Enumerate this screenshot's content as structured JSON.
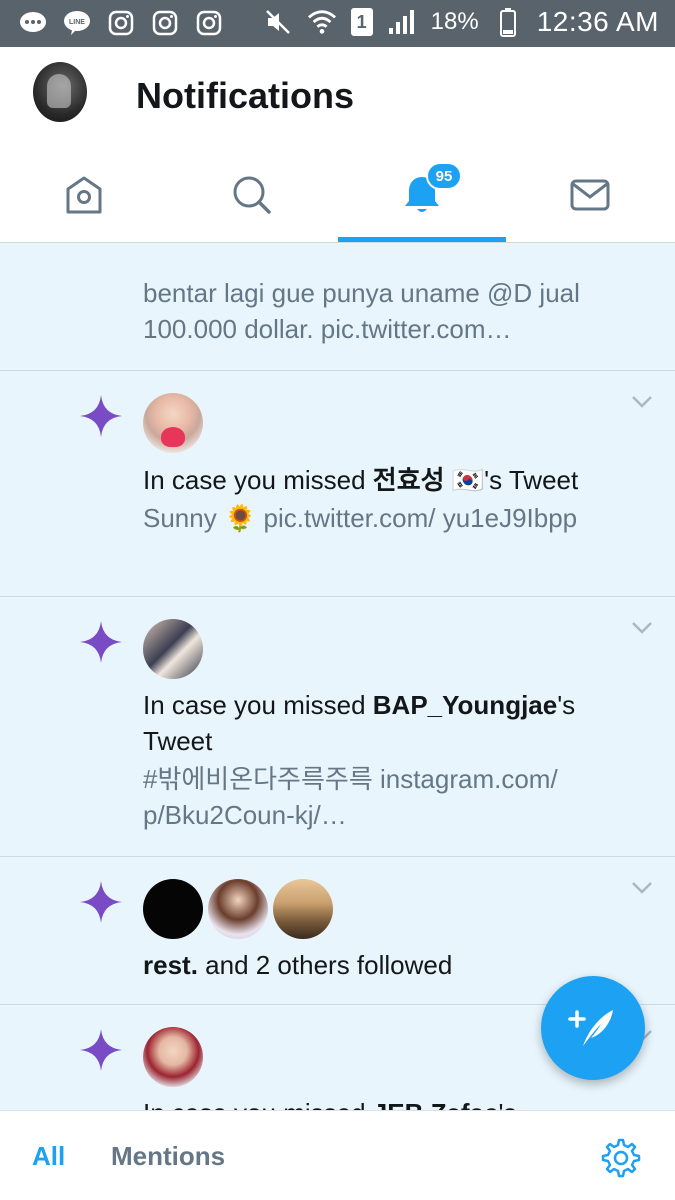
{
  "status_bar": {
    "icons": [
      "chat-icon",
      "line-icon",
      "instagram-icon",
      "instagram-icon",
      "instagram-icon"
    ],
    "sim": "1",
    "battery": "18%",
    "time": "12:36 AM"
  },
  "header": {
    "title": "Notifications"
  },
  "tabs": {
    "items": [
      "home-icon",
      "search-icon",
      "notifications-icon",
      "messages-icon"
    ],
    "badge": "95",
    "active_color": "#1da1f2"
  },
  "feed": {
    "items": [
      {
        "text": "bentar lagi gue punya uname @D jual 100.000 dollar. pic.twitter.com…"
      },
      {
        "prefix": "In case you missed ",
        "user": "전효성 🇰🇷",
        "suffix": "'s Tweet",
        "sub": "Sunny 🌻 pic.twitter.com/ yu1eJ9Ibpp"
      },
      {
        "prefix": "In case you missed ",
        "user": "BAP_Youngjae",
        "suffix": "'s Tweet",
        "sub": "#밖에비온다주륵주륵 instagram.com/ p/Bku2Coun-kj/…"
      },
      {
        "user": "rest.",
        "suffix": " and 2 others followed"
      },
      {
        "prefix": "In case you missed ",
        "user": "JEB Zafac",
        "suffix": "'s"
      }
    ]
  },
  "bottom_bar": {
    "all_label": "All",
    "mentions_label": "Mentions"
  },
  "colors": {
    "accent": "#1da1f2",
    "sparkle": "#794bc4",
    "feed_background": "#e8f5fd"
  }
}
